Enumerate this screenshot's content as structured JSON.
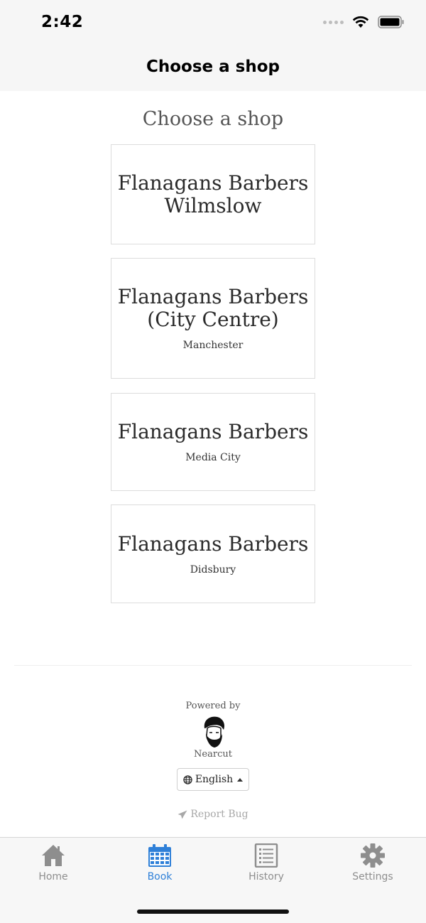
{
  "status_bar": {
    "time": "2:42"
  },
  "nav": {
    "title": "Choose a shop"
  },
  "page": {
    "heading": "Choose a shop"
  },
  "shops": [
    {
      "name_line1": "Flanagans Barbers",
      "name_line2": "Wilmslow",
      "location": ""
    },
    {
      "name_line1": "Flanagans Barbers",
      "name_line2": "(City Centre)",
      "location": "Manchester"
    },
    {
      "name_line1": "Flanagans Barbers",
      "name_line2": "",
      "location": "Media City"
    },
    {
      "name_line1": "Flanagans Barbers",
      "name_line2": "",
      "location": "Didsbury"
    }
  ],
  "footer": {
    "powered_by": "Powered by",
    "brand": "Nearcut",
    "language": "English",
    "report_bug": "Report Bug"
  },
  "tabs": [
    {
      "label": "Home",
      "icon": "home-icon",
      "active": false
    },
    {
      "label": "Book",
      "icon": "calendar-icon",
      "active": true
    },
    {
      "label": "History",
      "icon": "list-icon",
      "active": false
    },
    {
      "label": "Settings",
      "icon": "gear-icon",
      "active": false
    }
  ],
  "colors": {
    "accent": "#2f80d8",
    "tab_inactive": "#8e8e8e",
    "bar_background": "#f6f6f6"
  }
}
